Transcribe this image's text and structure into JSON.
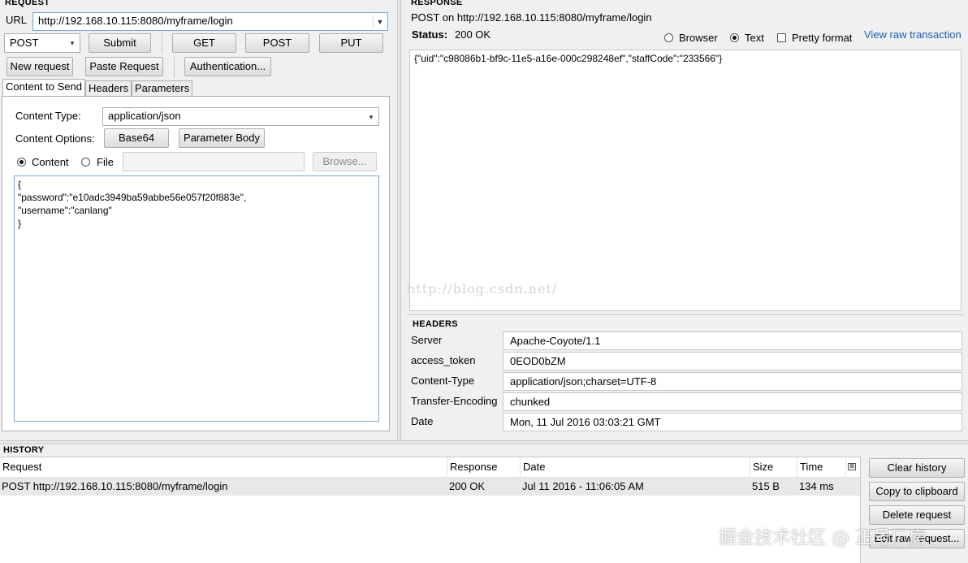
{
  "request": {
    "title": "REQUEST",
    "url_label": "URL",
    "url_value": "http://192.168.10.115:8080/myframe/login",
    "method": "POST",
    "buttons": {
      "submit": "Submit",
      "get": "GET",
      "post": "POST",
      "put": "PUT",
      "new_request": "New request",
      "paste_request": "Paste Request",
      "authentication": "Authentication..."
    },
    "tabs": [
      "Content to Send",
      "Headers",
      "Parameters"
    ],
    "content_type_label": "Content Type:",
    "content_type_value": "application/json",
    "content_options_label": "Content Options:",
    "base64_label": "Base64",
    "parameter_body_label": "Parameter Body",
    "content_radio_label": "Content",
    "file_radio_label": "File",
    "browse_label": "Browse...",
    "body_lines": [
      "{",
      "\"password\":\"e10adc3949ba59abbe56e057f20f883e\",",
      "\"username\":\"canlang\"",
      "}"
    ]
  },
  "response": {
    "title": "RESPONSE",
    "summary": "POST on http://192.168.10.115:8080/myframe/login",
    "status_label": "Status:",
    "status_value": "200 OK",
    "view_options": {
      "browser": "Browser",
      "text": "Text",
      "pretty_format": "Pretty format"
    },
    "view_raw_link": "View raw transaction",
    "body": "{\"uid\":\"c98086b1-bf9c-11e5-a16e-000c298248ef\",\"staffCode\":\"233566\"}",
    "watermark": "http://blog.csdn.net/",
    "headers_title": "HEADERS",
    "headers": [
      {
        "name": "Server",
        "value": "Apache-Coyote/1.1"
      },
      {
        "name": "access_token",
        "value": "0EOD0bZM"
      },
      {
        "name": "Content-Type",
        "value": "application/json;charset=UTF-8"
      },
      {
        "name": "Transfer-Encoding",
        "value": "chunked"
      },
      {
        "name": "Date",
        "value": "Mon, 11 Jul 2016 03:03:21 GMT"
      }
    ]
  },
  "history": {
    "title": "HISTORY",
    "columns": [
      "Request",
      "Response",
      "Date",
      "Size",
      "Time"
    ],
    "rows": [
      {
        "request": "POST http://192.168.10.115:8080/myframe/login",
        "response": "200 OK",
        "date": "Jul 11 2016 - 11:06:05 AM",
        "size": "515 B",
        "time": "134 ms"
      }
    ],
    "buttons": {
      "clear": "Clear history",
      "copy": "Copy to clipboard",
      "delete": "Delete request",
      "edit": "Edit raw request..."
    }
  },
  "overlay_watermark": "掘金技术社区 @ 正号厂房",
  "colors": {
    "link": "#1a5fb4",
    "selection_row": "#e8e8e8",
    "focus_border": "#7aa7d9"
  }
}
